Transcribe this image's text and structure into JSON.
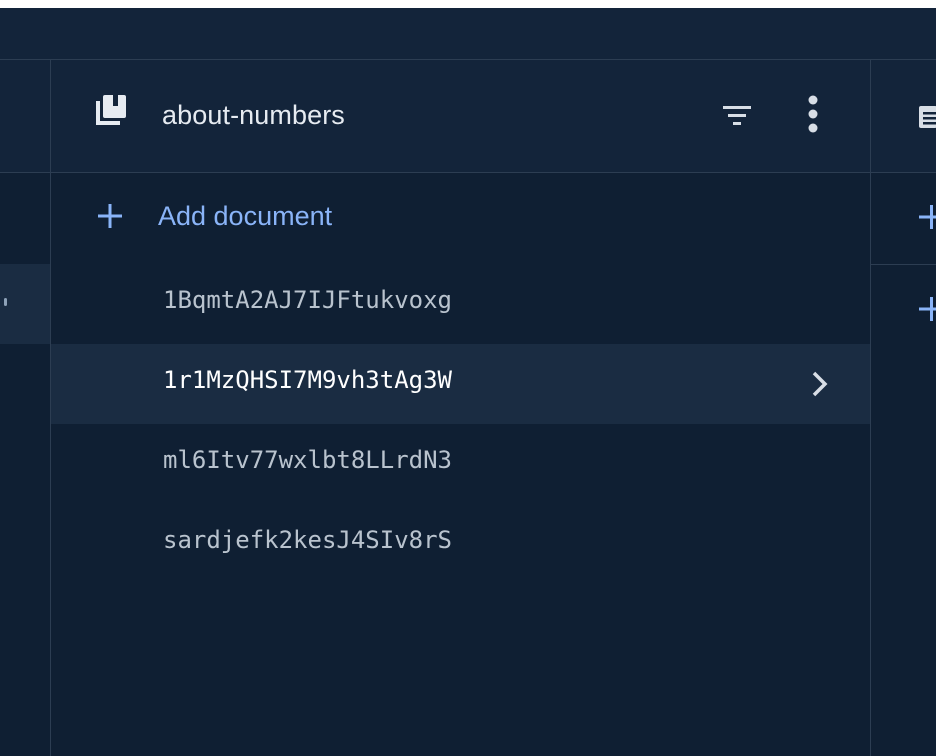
{
  "collection": {
    "title": "about-numbers",
    "icon": "collection-icon"
  },
  "header_actions": {
    "filter_icon": "filter-icon",
    "more_icon": "more-vert-icon"
  },
  "add_document": {
    "label": "Add document",
    "icon": "plus-icon"
  },
  "documents": [
    {
      "id": "1BqmtA2AJ7IJFtukvoxg",
      "selected": false
    },
    {
      "id": "1r1MzQHSI7M9vh3tAg3W",
      "selected": true
    },
    {
      "id": "ml6Itv77wxlbt8LLrdN3",
      "selected": false
    },
    {
      "id": "sardjefk2kesJ4SIv8rS",
      "selected": false
    }
  ],
  "colors": {
    "background": "#0f1f33",
    "header": "#13243a",
    "selected_row": "#1a2c42",
    "accent": "#8ab4f8",
    "border": "#2c3d52"
  }
}
